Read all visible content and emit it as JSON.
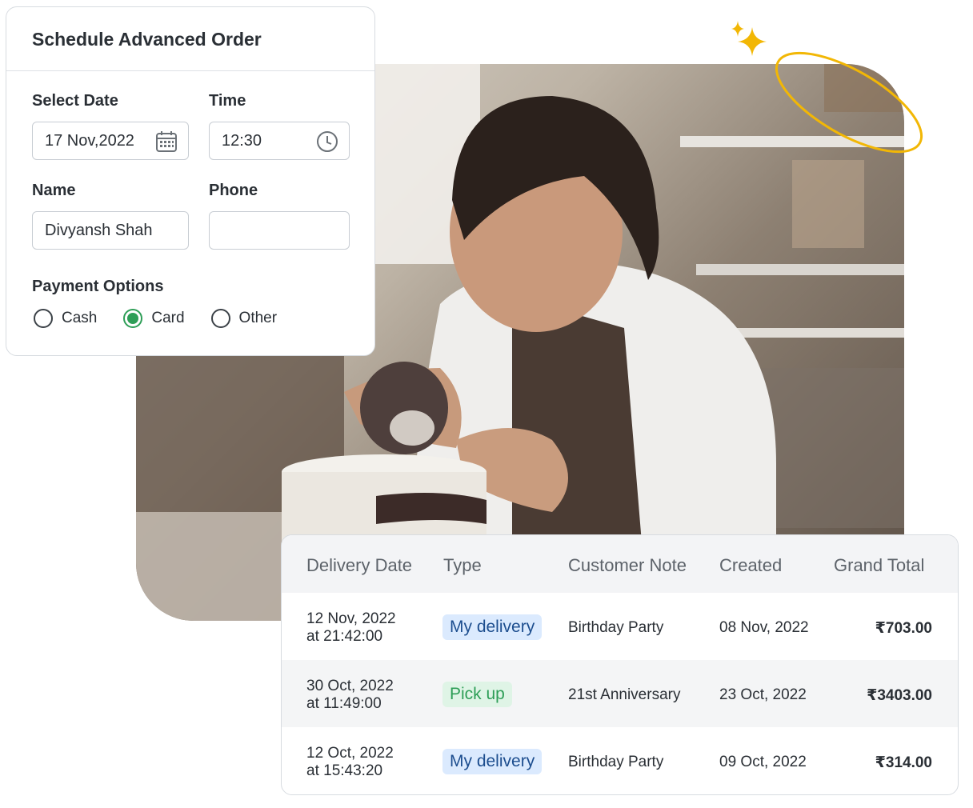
{
  "schedule_form": {
    "title": "Schedule Advanced Order",
    "date_label": "Select Date",
    "date_value": "17 Nov,2022",
    "time_label": "Time",
    "time_value": "12:30",
    "name_label": "Name",
    "name_value": "Divyansh Shah",
    "phone_label": "Phone",
    "phone_value": "",
    "payment_label": "Payment Options",
    "payment_options": [
      {
        "label": "Cash",
        "selected": false
      },
      {
        "label": "Card",
        "selected": true
      },
      {
        "label": "Other",
        "selected": false
      }
    ]
  },
  "orders_table": {
    "columns": [
      "Delivery Date",
      "Type",
      "Customer Note",
      "Created",
      "Grand Total"
    ],
    "rows": [
      {
        "date": "12 Nov, 2022",
        "time": "at 21:42:00",
        "type": "My delivery",
        "note": "Birthday Party",
        "created": "08 Nov, 2022",
        "total": "₹703.00"
      },
      {
        "date": "30 Oct, 2022",
        "time": "at 11:49:00",
        "type": "Pick up",
        "note": "21st Anniversary",
        "created": "23 Oct, 2022",
        "total": "₹3403.00"
      },
      {
        "date": "12 Oct, 2022",
        "time": "at 15:43:20",
        "type": "My delivery",
        "note": "Birthday Party",
        "created": "09 Oct, 2022",
        "total": "₹314.00"
      }
    ]
  },
  "colors": {
    "accent_green": "#2e9e57",
    "badge_blue_bg": "#dbeafe",
    "badge_blue_text": "#1d4e8f",
    "badge_green_bg": "#dff4e6",
    "sparkle_yellow": "#f2b705"
  },
  "icons": [
    "calendar-icon",
    "clock-icon",
    "sparkle-icon"
  ]
}
